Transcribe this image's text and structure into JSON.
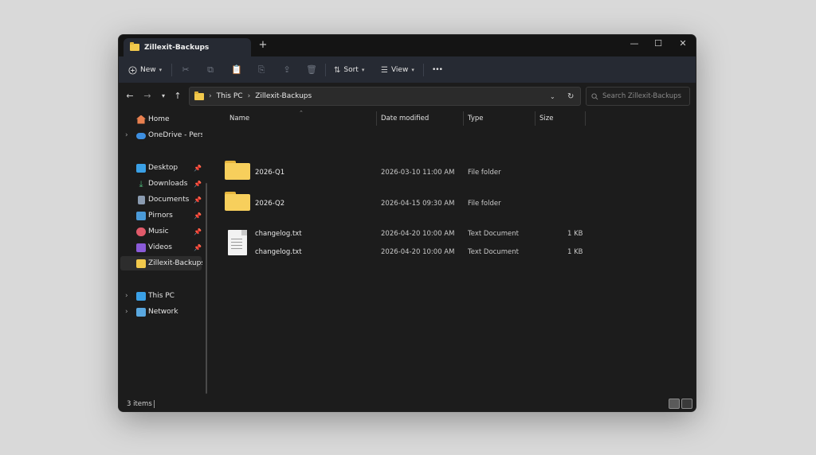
{
  "window": {
    "tab_title": "Zillexit-Backups",
    "new_tab": "+",
    "minimize": "—",
    "maximize": "☐",
    "close": "✕"
  },
  "toolbar": {
    "new_label": "New",
    "sort_label": "Sort",
    "view_label": "View",
    "more_label": "•••",
    "icons": [
      "cut-icon",
      "copy-icon",
      "paste-icon",
      "rename-icon",
      "share-icon",
      "delete-icon"
    ]
  },
  "address": {
    "crumbs": [
      "This PC",
      "Zillexit-Backups"
    ],
    "search_placeholder": "Search Zillexit-Backups"
  },
  "sidebar": {
    "items": [
      {
        "label": "Home",
        "color": "#e8804f"
      },
      {
        "label": "OneDrive - Persoi",
        "color": "#3d8ee0"
      },
      {
        "label": "Desktop",
        "color": "#3aa0e6"
      },
      {
        "label": "Downloads",
        "color": "#4fb87a"
      },
      {
        "label": "Documents",
        "color": "#8a9bb0"
      },
      {
        "label": "Pirnors",
        "color": "#4a9ad8"
      },
      {
        "label": "Music",
        "color": "#e05a6a"
      },
      {
        "label": "Videos",
        "color": "#8a5ad8"
      },
      {
        "label": "Zillexit-Backups",
        "color": "#f2c94c"
      },
      {
        "label": "This PC",
        "color": "#3aa0e6"
      },
      {
        "label": "Network",
        "color": "#5aa8e0"
      }
    ]
  },
  "columns": {
    "name": "Name",
    "date": "Date modified",
    "type": "Type",
    "size": "Size"
  },
  "files": [
    {
      "name": "2026-Q1",
      "date": "2026-03-10 11:00 AM",
      "type": "File folder",
      "size": ""
    },
    {
      "name": "2026-Q2",
      "date": "2026-04-15 09:30 AM",
      "type": "File folder",
      "size": ""
    },
    {
      "name": "changelog.txt",
      "date": "2026-04-20 10:00 AM",
      "type": "Text Document",
      "size": "1 KB"
    },
    {
      "name": "changelog.txt",
      "date": "2026-04-20 10:00 AM",
      "type": "Text Document",
      "size": "1 KB"
    }
  ],
  "status": {
    "items_text": "3 items"
  }
}
